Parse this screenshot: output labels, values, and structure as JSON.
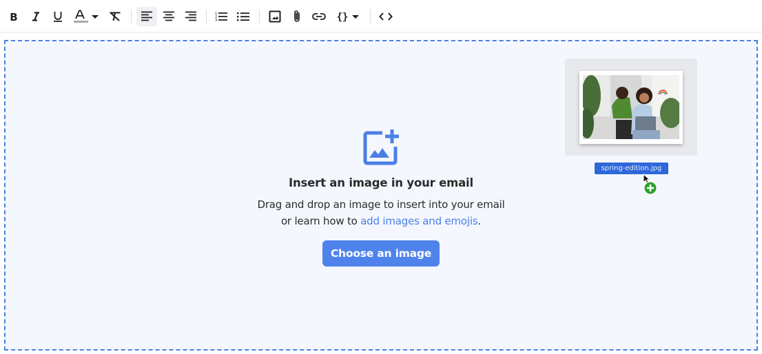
{
  "toolbar": {
    "buttons": [
      {
        "name": "bold",
        "icon": "bold-icon"
      },
      {
        "name": "italic",
        "icon": "italic-icon"
      },
      {
        "name": "underline",
        "icon": "underline-icon"
      },
      {
        "name": "text-color",
        "icon": "text-color-icon",
        "has_dropdown": true
      },
      {
        "name": "clear-formatting",
        "icon": "clear-formatting-icon"
      },
      {
        "name": "align-left",
        "icon": "align-left-icon",
        "active": true
      },
      {
        "name": "align-center",
        "icon": "align-center-icon"
      },
      {
        "name": "align-right",
        "icon": "align-right-icon"
      },
      {
        "name": "numbered-list",
        "icon": "numbered-list-icon"
      },
      {
        "name": "bulleted-list",
        "icon": "bulleted-list-icon"
      },
      {
        "name": "insert-image",
        "icon": "image-icon"
      },
      {
        "name": "attach-file",
        "icon": "paperclip-icon"
      },
      {
        "name": "insert-link",
        "icon": "link-icon"
      },
      {
        "name": "insert-variable",
        "icon": "curly-braces-icon",
        "has_dropdown": true
      },
      {
        "name": "source-code",
        "icon": "code-icon"
      }
    ]
  },
  "dropzone": {
    "icon": "add-image-icon",
    "title": "Insert an image in your email",
    "description_line1": "Drag and drop an image to insert into your email",
    "description_line2_prefix": "or learn how to ",
    "description_link": "add images and emojis",
    "description_line2_suffix": ".",
    "choose_button_label": "Choose an image"
  },
  "drag_preview": {
    "filename": "spring-edition.jpg",
    "cursor_icon": "arrow-cursor-icon",
    "copy_badge_icon": "plus-circle-icon"
  },
  "colors": {
    "accent": "#4f83ec",
    "link": "#4a7fe5",
    "dropzone_border": "#4b7fe6",
    "dropzone_bg": "#f4f7fd",
    "filename_badge": "#2d67d9",
    "copy_badge": "#2ea02e"
  }
}
